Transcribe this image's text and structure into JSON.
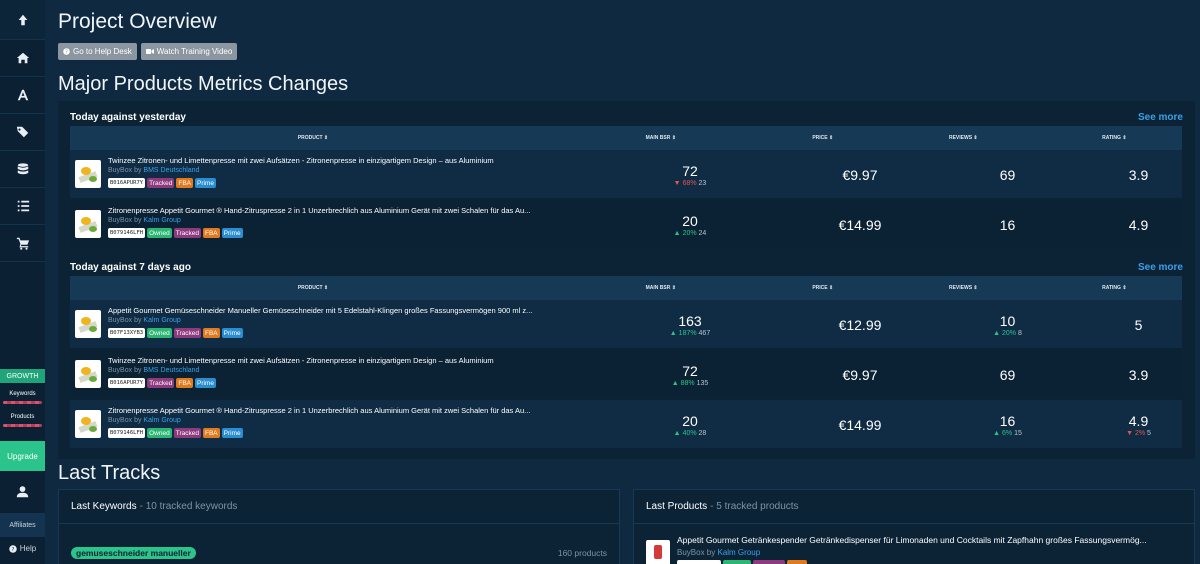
{
  "sidebar": {
    "growth": "GROWTH",
    "keywords": "Keywords",
    "products": "Products",
    "upgrade": "Upgrade",
    "affiliates": "Affiliates",
    "help": "Help"
  },
  "header": {
    "title": "Project Overview",
    "help_desk": "Go to Help Desk",
    "training": "Watch Training Video"
  },
  "metrics": {
    "title": "Major Products Metrics Changes",
    "see_more": "See more",
    "columns": {
      "product": "PRODUCT",
      "bsr": "MAIN BSR",
      "price": "PRICE",
      "reviews": "REVIEWS",
      "rating": "RATING"
    },
    "sections": [
      {
        "title": "Today against yesterday",
        "rows": [
          {
            "name": "Twinzee Zitronen- und Limettenpresse mit zwei Aufsätzen - Zitronenpresse in einzigartigem Design – aus Aluminium",
            "buybox_prefix": "BuyBox by",
            "buybox": "BMS Deutschland",
            "asin": "B016APUR7Y",
            "tags": [
              "Tracked",
              "FBA",
              "Prime"
            ],
            "bsr": "72",
            "bsr_dir": "down",
            "bsr_pct": "68%",
            "bsr_delta": "23",
            "price": "€9.97",
            "reviews": "69",
            "rating": "3.9"
          },
          {
            "name": "Zitronenpresse Appetit Gourmet ® Hand-Zitruspresse 2 in 1 Unzerbrechlich aus Aluminium Gerät mit zwei Schalen für das Au...",
            "buybox_prefix": "BuyBox by",
            "buybox": "Kalm Group",
            "asin": "B079146LFH",
            "tags": [
              "Owned",
              "Tracked",
              "FBA",
              "Prime"
            ],
            "bsr": "20",
            "bsr_dir": "up",
            "bsr_pct": "20%",
            "bsr_delta": "24",
            "price": "€14.99",
            "reviews": "16",
            "rating": "4.9"
          }
        ]
      },
      {
        "title": "Today against 7 days ago",
        "rows": [
          {
            "name": "Appetit Gourmet Gemüseschneider Manueller Gemüseschneider mit 5 Edelstahl-Klingen großes Fassungsvermögen 900 ml z...",
            "buybox_prefix": "BuyBox by",
            "buybox": "Kalm Group",
            "asin": "B07F13XYB3",
            "tags": [
              "Owned",
              "Tracked",
              "FBA",
              "Prime"
            ],
            "bsr": "163",
            "bsr_dir": "up",
            "bsr_pct": "187%",
            "bsr_delta": "467",
            "price": "€12.99",
            "reviews": "10",
            "rev_dir": "up",
            "rev_pct": "20%",
            "rev_delta": "8",
            "rating": "5"
          },
          {
            "name": "Twinzee Zitronen- und Limettenpresse mit zwei Aufsätzen - Zitronenpresse in einzigartigem Design – aus Aluminium",
            "buybox_prefix": "BuyBox by",
            "buybox": "BMS Deutschland",
            "asin": "B016APUR7Y",
            "tags": [
              "Tracked",
              "FBA",
              "Prime"
            ],
            "bsr": "72",
            "bsr_dir": "up",
            "bsr_pct": "88%",
            "bsr_delta": "135",
            "price": "€9.97",
            "reviews": "69",
            "rating": "3.9"
          },
          {
            "name": "Zitronenpresse Appetit Gourmet ® Hand-Zitruspresse 2 in 1 Unzerbrechlich aus Aluminium Gerät mit zwei Schalen für das Au...",
            "buybox_prefix": "BuyBox by",
            "buybox": "Kalm Group",
            "asin": "B079146LFH",
            "tags": [
              "Owned",
              "Tracked",
              "FBA",
              "Prime"
            ],
            "bsr": "20",
            "bsr_dir": "up",
            "bsr_pct": "40%",
            "bsr_delta": "28",
            "price": "€14.99",
            "reviews": "16",
            "rev_dir": "up",
            "rev_pct": "6%",
            "rev_delta": "15",
            "rating": "4.9",
            "rat_dir": "down",
            "rat_pct": "2%",
            "rat_delta": "5"
          }
        ]
      }
    ]
  },
  "last_tracks": {
    "title": "Last Tracks",
    "keywords": {
      "title": "Last Keywords",
      "subtitle": "- 10 tracked keywords",
      "keyword": "gemuseschneider manueller",
      "count": "160 products"
    },
    "products": {
      "title": "Last Products",
      "subtitle": "- 5 tracked products",
      "name": "Appetit Gourmet Getränkespender Getränkedispenser für Limonaden und Cocktails mit Zapfhahn großes Fassungsvermög...",
      "buybox_prefix": "BuyBox by",
      "buybox": "Kalm Group"
    }
  },
  "colors": {
    "up": "#2bc48a",
    "down": "#e45454",
    "link": "#3aa0e8"
  }
}
